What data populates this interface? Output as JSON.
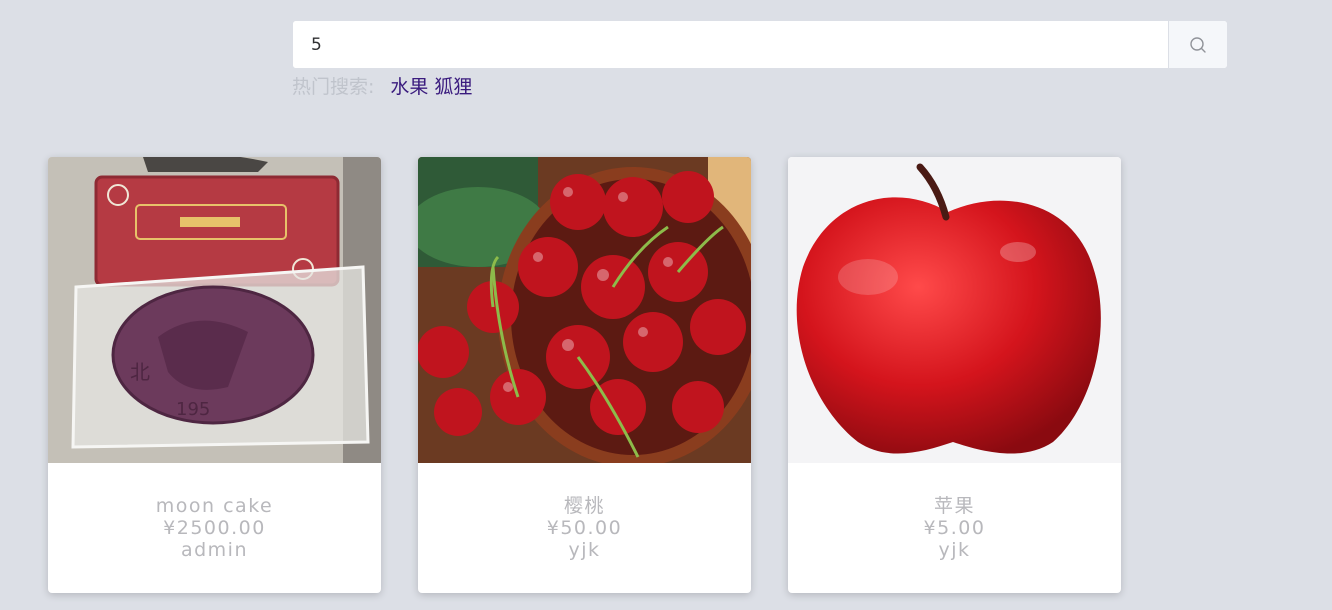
{
  "search": {
    "value": "5",
    "icon": "search-icon"
  },
  "hot_search": {
    "label": "热门搜索:",
    "terms": [
      "水果",
      "狐狸"
    ]
  },
  "products": [
    {
      "name": "moon cake",
      "price": "¥2500.00",
      "seller": "admin",
      "image": "mooncake-photo"
    },
    {
      "name": "樱桃",
      "price": "¥50.00",
      "seller": "yjk",
      "image": "cherries-photo"
    },
    {
      "name": "苹果",
      "price": "¥5.00",
      "seller": "yjk",
      "image": "apple-photo"
    }
  ],
  "colors": {
    "background": "#dcdfe6",
    "hot_link": "#3a1b7e",
    "card_text": "#b8b8bc"
  }
}
